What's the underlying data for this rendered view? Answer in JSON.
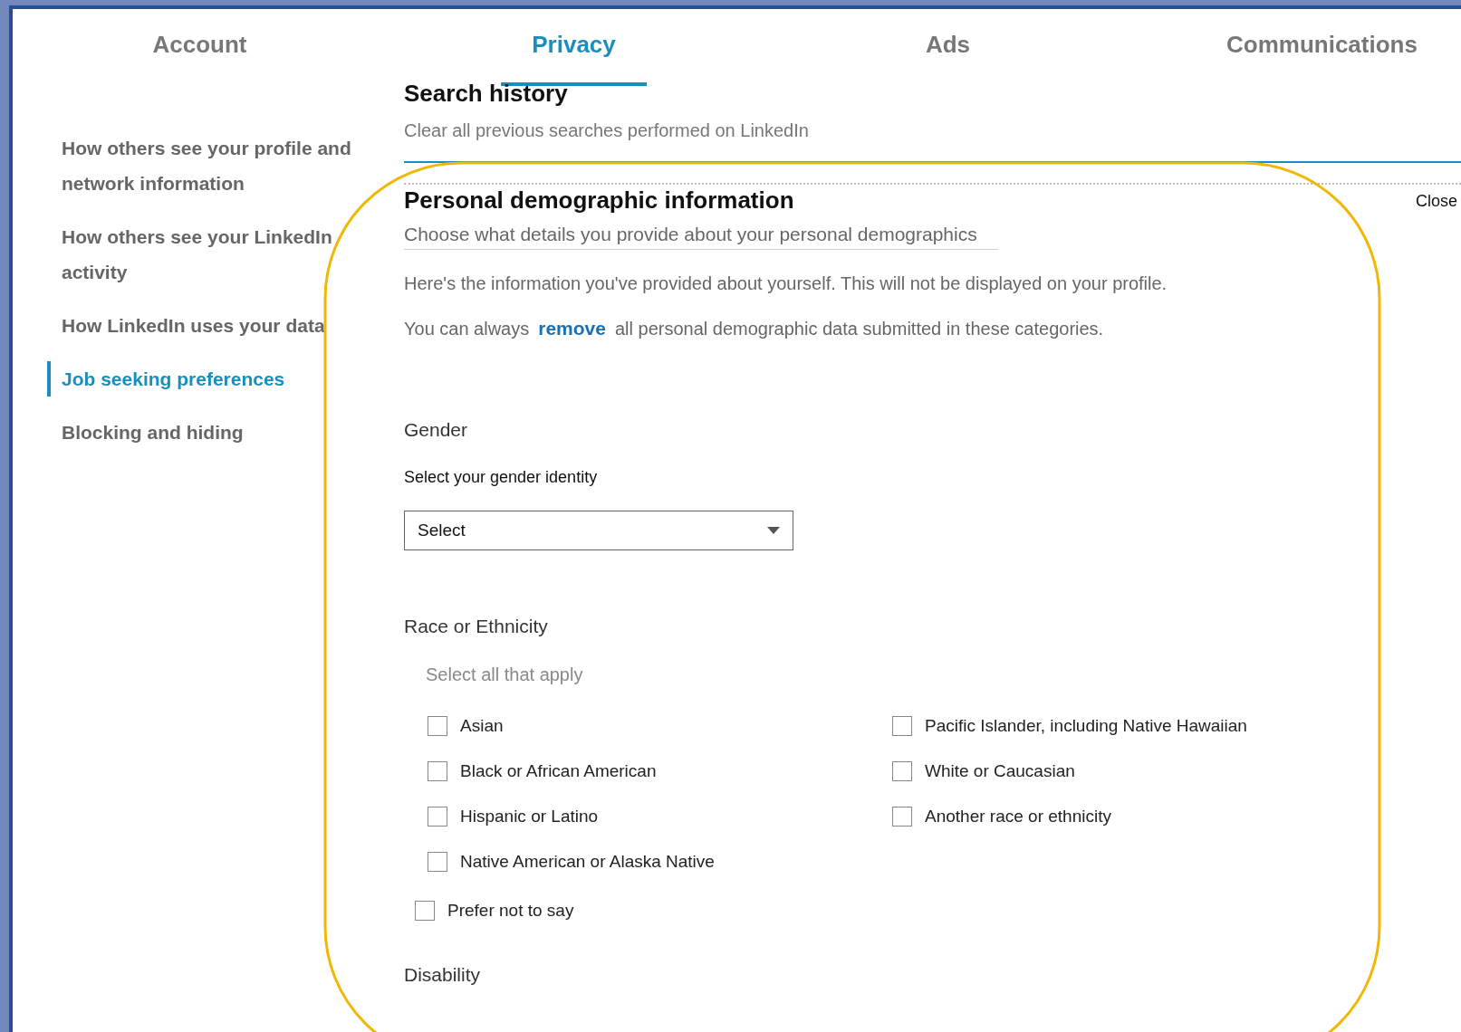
{
  "tabs": [
    {
      "label": "Account",
      "selected": false
    },
    {
      "label": "Privacy",
      "selected": true
    },
    {
      "label": "Ads",
      "selected": false
    },
    {
      "label": "Communications",
      "selected": false
    }
  ],
  "sidebar": {
    "items": [
      {
        "label": "How others see your profile and network information",
        "selected": false
      },
      {
        "label": "How others see your LinkedIn activity",
        "selected": false
      },
      {
        "label": "How LinkedIn uses your data",
        "selected": false
      },
      {
        "label": "Job seeking preferences",
        "selected": true
      },
      {
        "label": "Blocking and hiding",
        "selected": false
      }
    ]
  },
  "search_history": {
    "title": "Search history",
    "description": "Clear all previous searches performed on LinkedIn"
  },
  "demographics": {
    "title": "Personal demographic information",
    "subtitle": "Choose what details you provide about your personal demographics",
    "close": "Close",
    "info": "Here's the information you've provided about yourself. This will not be displayed on your profile.",
    "remove_before": "You can always",
    "remove_link": "remove",
    "remove_after": "all personal demographic data submitted in these categories.",
    "gender": {
      "heading": "Gender",
      "label": "Select your gender identity",
      "value": "Select"
    },
    "race": {
      "heading": "Race or Ethnicity",
      "hint": "Select all that apply",
      "options": [
        {
          "label": "Asian",
          "checked": false
        },
        {
          "label": "Black or African American",
          "checked": false
        },
        {
          "label": "Hispanic or Latino",
          "checked": false
        },
        {
          "label": "Native American or Alaska Native",
          "checked": false
        },
        {
          "label": "Pacific Islander, including Native Hawaiian",
          "checked": false
        },
        {
          "label": "White or Caucasian",
          "checked": false
        },
        {
          "label": "Another race or ethnicity",
          "checked": false
        }
      ],
      "prefer_not": {
        "label": "Prefer not to say",
        "checked": false
      }
    },
    "disability": {
      "heading": "Disability"
    }
  }
}
